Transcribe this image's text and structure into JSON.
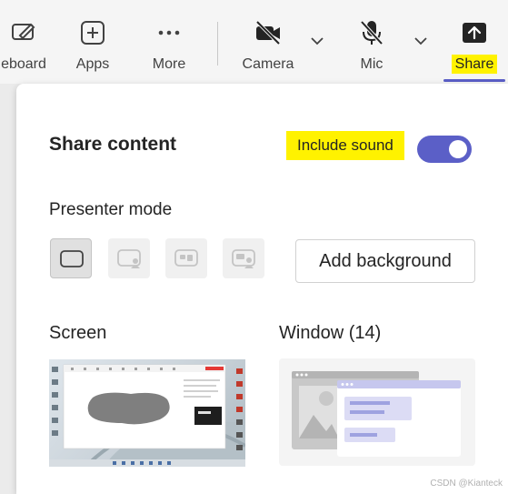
{
  "toolbar": {
    "items": [
      {
        "label": "eboard",
        "icon": "whiteboard-icon"
      },
      {
        "label": "Apps",
        "icon": "add-square-icon"
      },
      {
        "label": "More",
        "icon": "more-dots-icon"
      },
      {
        "label": "Camera",
        "icon": "camera-off-icon"
      },
      {
        "label": "Mic",
        "icon": "mic-off-icon"
      },
      {
        "label": "Share",
        "icon": "share-upload-icon"
      }
    ]
  },
  "panel": {
    "title": "Share content",
    "include_sound_label": "Include sound",
    "include_sound_on": true,
    "presenter_mode_title": "Presenter mode",
    "presenter_modes": [
      {
        "name": "content-only",
        "selected": true
      },
      {
        "name": "standout",
        "selected": false
      },
      {
        "name": "side-by-side",
        "selected": false
      },
      {
        "name": "reporter",
        "selected": false
      }
    ],
    "add_background_label": "Add background",
    "screen_title": "Screen",
    "window_title": "Window (14)"
  },
  "watermark": "CSDN @Kianteck",
  "colors": {
    "accent": "#5b5fc7",
    "highlight": "#fff200",
    "toolbar_bg": "#f5f5f5",
    "panel_bg": "#ffffff"
  }
}
